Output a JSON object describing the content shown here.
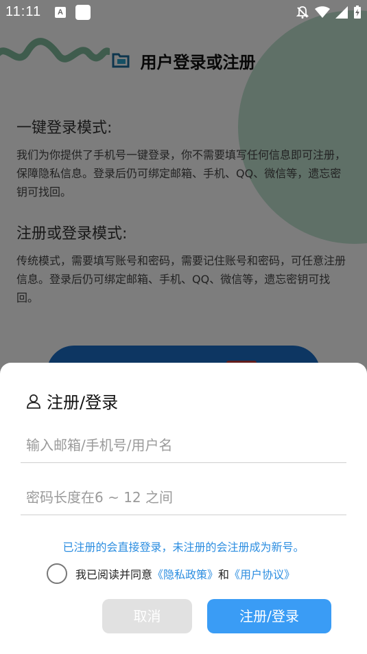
{
  "status_bar": {
    "time": "11:11",
    "keyboard_indicator": "A"
  },
  "background": {
    "header_title": "用户登录或注册",
    "section1_title": "一键登录模式:",
    "section1_body": "我们为你提供了手机号一键登录，你不需要填写任何信息即可注册，保障隐私信息。登录后仍可绑定邮箱、手机、QQ、微信等，遗忘密钥可找回。",
    "section2_title": "注册或登录模式:",
    "section2_body": "传统模式，需要填写账号和密码，需要记住账号和密码，可任意注册信息。登录后仍可绑定邮箱、手机、QQ、微信等，遗忘密钥可找回。"
  },
  "dialog": {
    "title": "注册/登录",
    "account_placeholder": "输入邮箱/手机号/用户名",
    "password_placeholder": "密码长度在6 ~ 12 之间",
    "notice": "已注册的会直接登录，未注册的会注册成为新号。",
    "agree_prefix": "我已阅读并同意",
    "privacy_link": "《隐私政策》",
    "agree_and": "和",
    "user_agreement_link": "《用户协议》",
    "cancel_label": "取消",
    "submit_label": "注册/登录"
  },
  "colors": {
    "accent": "#3a9cf5",
    "link": "#2b8de0",
    "cancel_bg": "#e1e1e1"
  }
}
